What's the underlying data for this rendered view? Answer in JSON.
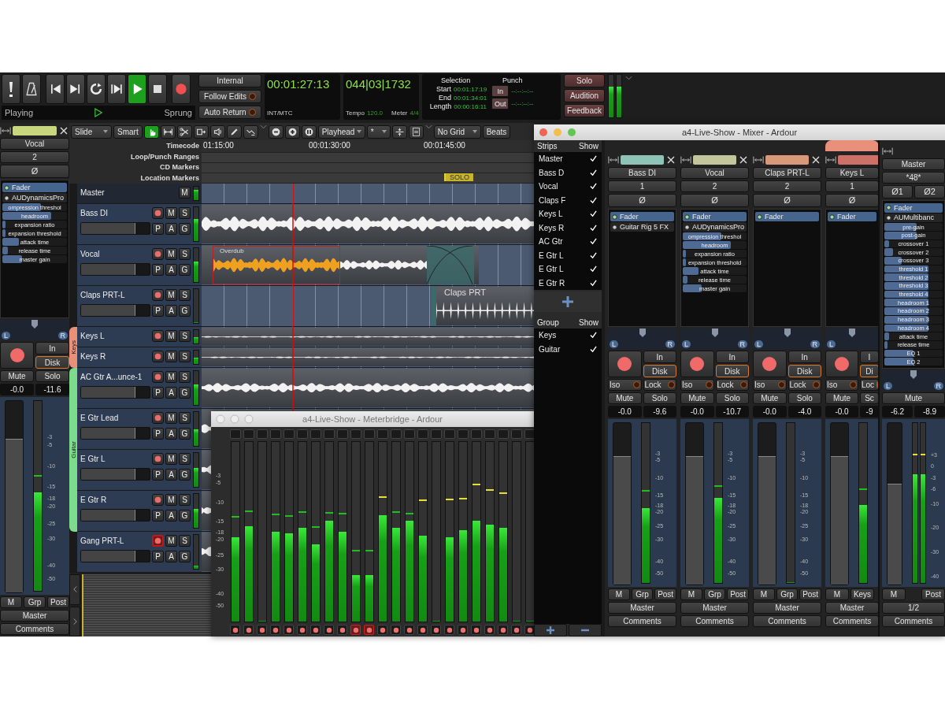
{
  "transport": {
    "buttons": [
      {
        "on": false
      },
      {
        "on": false
      },
      {
        "on": false
      },
      {
        "on": false
      },
      {
        "on": false
      },
      {
        "on": false
      },
      {
        "on": true
      },
      {
        "on": false
      },
      {
        "on": false
      }
    ],
    "status": "Playing",
    "status_right": "Sprung",
    "sync": [
      {
        "label": "Internal",
        "kind": "plain"
      },
      {
        "label": "Follow Edits",
        "kind": "led",
        "on": false
      },
      {
        "label": "Auto Return",
        "kind": "led",
        "on": false
      }
    ],
    "clocks": [
      {
        "time": "00:01:27:13",
        "footer": [
          {
            "label": "INT/MTC"
          }
        ]
      },
      {
        "time": "044|03|1732",
        "footer": [
          {
            "label": "Tempo",
            "value": "120.0"
          },
          {
            "label": "Meter",
            "value": "4/4"
          }
        ]
      }
    ],
    "selection": {
      "title": "Selection",
      "rows": [
        {
          "label": "Start",
          "value": "00:01:17:19"
        },
        {
          "label": "End",
          "value": "00:01:34:01"
        },
        {
          "label": "Length",
          "value": "00:00:16:11"
        }
      ]
    },
    "punch": {
      "title": "Punch",
      "rows": [
        {
          "button": "In",
          "value": "--:--:--:--"
        },
        {
          "button": "Out",
          "value": "--:--:--:--"
        }
      ]
    },
    "monitor_buttons": [
      "Solo",
      "Audition",
      "Feedback"
    ],
    "meters": [
      {
        "level": 0.72
      },
      {
        "level": 0.72
      }
    ]
  },
  "editor_toolbar": {
    "edit_mode": "Slide",
    "mode_button": "Smart",
    "tools": [
      {
        "selected": true
      },
      {
        "selected": false
      },
      {
        "selected": false
      },
      {
        "selected": false
      },
      {
        "selected": false
      },
      {
        "selected": false
      },
      {
        "selected": false
      }
    ],
    "zoom_focus": "Playhead",
    "snap": "*",
    "grid": "No Grid",
    "grid_unit": "Beats"
  },
  "rulers": [
    {
      "label": "Timecode"
    },
    {
      "label": "Loop/Punch Ranges"
    },
    {
      "label": "CD Markers"
    },
    {
      "label": "Location Markers"
    }
  ],
  "timecode_ticks": [
    "01:15:00",
    "00:01:30:00",
    "00:01:45:00"
  ],
  "markers": [
    {
      "label": "SOLO"
    }
  ],
  "master_track": {
    "name": "Master",
    "buttons": [
      "M"
    ],
    "meter": {
      "level": 0.75
    }
  },
  "track_list": [
    {
      "name": "Bass DI",
      "kind": "full",
      "expanded": true,
      "rec_armed": false,
      "buttons": [
        "M",
        "S"
      ],
      "extra_buttons": [
        "P",
        "A",
        "G"
      ],
      "fader": {
        "level": 0.78
      },
      "meter": {
        "level": 0.65
      }
    },
    {
      "name": "Vocal",
      "kind": "overdub",
      "expanded": true,
      "rec_armed": false,
      "buttons": [
        "M",
        "S"
      ],
      "extra_buttons": [
        "P",
        "A",
        "G"
      ],
      "fader": {
        "level": 0.78
      },
      "meter": {
        "level": 0.6
      },
      "region_label": "Overdub"
    },
    {
      "name": "Claps PRT-L",
      "kind": "claps",
      "expanded": true,
      "rec_armed": false,
      "buttons": [
        "M",
        "S"
      ],
      "extra_buttons": [
        "P",
        "A",
        "G"
      ],
      "fader": {
        "level": 0.78
      },
      "meter": {
        "level": 0
      },
      "region_label": "Claps PRT"
    },
    {
      "group": "Keys",
      "color": "#e8907a",
      "tracks": [
        {
          "name": "Keys L",
          "kind": "thin",
          "expanded": false,
          "rec_armed": false,
          "buttons": [
            "M",
            "S"
          ],
          "meter": {
            "level": 0.5
          }
        },
        {
          "name": "Keys R",
          "kind": "thin",
          "expanded": false,
          "rec_armed": false,
          "buttons": [
            "M",
            "S"
          ],
          "meter": {
            "level": 0.5
          }
        }
      ]
    },
    {
      "group": "Guitar",
      "color": "#7ddc8c",
      "tracks": [
        {
          "name": "AC Gtr A...unce-1",
          "kind": "dense",
          "expanded": true,
          "rec_armed": false,
          "buttons": [
            "M",
            "S"
          ],
          "extra_buttons": [
            "P",
            "A",
            "G"
          ],
          "fader": {
            "level": 0.78
          },
          "meter": {
            "level": 0.6
          }
        },
        {
          "name": "E Gtr Lead",
          "kind": "dense",
          "expanded": true,
          "rec_armed": false,
          "buttons": [
            "M",
            "S"
          ],
          "extra_buttons": [
            "P",
            "A",
            "G"
          ],
          "fader": {
            "level": 0.78
          },
          "meter": {
            "level": 0.5
          }
        },
        {
          "name": "E Gtr L",
          "kind": "dense",
          "expanded": true,
          "rec_armed": false,
          "buttons": [
            "M",
            "S"
          ],
          "extra_buttons": [
            "P",
            "A",
            "G"
          ],
          "fader": {
            "level": 0.78
          },
          "meter": {
            "level": 0.55
          }
        },
        {
          "name": "E Gtr R",
          "kind": "dense",
          "expanded": true,
          "rec_armed": false,
          "buttons": [
            "M",
            "S"
          ],
          "extra_buttons": [
            "P",
            "A",
            "G"
          ],
          "fader": {
            "level": 0.78
          },
          "meter": {
            "level": 0.55
          }
        }
      ]
    },
    {
      "name": "Gang PRT-L",
      "kind": "dense",
      "expanded": true,
      "rec_armed": true,
      "buttons": [
        "M",
        "S"
      ],
      "extra_buttons": [
        "P",
        "A",
        "G"
      ],
      "fader": {
        "level": 0.78
      },
      "meter": {
        "level": 0.1
      }
    }
  ],
  "editor_strip": {
    "color": "#c8d67e",
    "name": "Vocal",
    "input": "2",
    "phase": [
      "Ø"
    ],
    "plugins": [
      {
        "name": "Fader",
        "active": true
      },
      {
        "name": "AUDynamicsPro",
        "active": false,
        "params": [
          {
            "name": "ompression threshol",
            "level": 0.6
          },
          {
            "name": "headroom",
            "level": 0.75
          },
          {
            "name": "expansion ratio",
            "level": 0.05
          },
          {
            "name": "expansion threshold",
            "level": 0.05
          },
          {
            "name": "attack time",
            "level": 0.25
          },
          {
            "name": "release time",
            "level": 0.08
          },
          {
            "name": "master gain",
            "level": 0.3
          }
        ]
      }
    ],
    "panner": {
      "left": "L",
      "right": "R"
    },
    "rec_armed": false,
    "monitor": [
      {
        "label": "In",
        "selected": false
      },
      {
        "label": "Disk",
        "selected": true
      }
    ],
    "mute": "Mute",
    "solo": "Solo",
    "gain": "-0.0",
    "peak": "-11.6",
    "fader": {
      "level": 0.8
    },
    "meter": {
      "level": 0.52,
      "peak": {
        "level": 0.6
      }
    },
    "scale": [
      "-3",
      "-5",
      "-10",
      "-15",
      "-18",
      "-20",
      "-25",
      "-30",
      "-40",
      "-50"
    ],
    "bottom": [
      "M",
      "Grp",
      "Post"
    ],
    "output": "Master",
    "comments": "Comments"
  },
  "mixer": {
    "title": "a4-Live-Show - Mixer - Ardour",
    "strips_header": {
      "title": "Strips",
      "show": "Show"
    },
    "strip_list": [
      {
        "name": "Master",
        "checked": true
      },
      {
        "name": "Bass D",
        "checked": true
      },
      {
        "name": "Vocal",
        "checked": true
      },
      {
        "name": "Claps F",
        "checked": true
      },
      {
        "name": "Keys L",
        "checked": true
      },
      {
        "name": "Keys R",
        "checked": true
      },
      {
        "name": "AC Gtr",
        "checked": true
      },
      {
        "name": "E Gtr L",
        "checked": true
      },
      {
        "name": "E Gtr L",
        "checked": true
      },
      {
        "name": "E Gtr R",
        "checked": true
      }
    ],
    "groups_header": {
      "title": "Group",
      "show": "Show"
    },
    "group_list": [
      {
        "name": "Keys",
        "checked": true
      },
      {
        "name": "Guitar",
        "checked": true
      }
    ],
    "strips": [
      {
        "kind": "full",
        "color": "#8fc3b5",
        "name": "Bass DI",
        "input": "1",
        "phase": "Ø",
        "plugins": [
          {
            "name": "Fader",
            "active": true
          },
          {
            "name": "Guitar Rig 5 FX",
            "active": false
          }
        ],
        "panner": {
          "left": "L",
          "right": "R"
        },
        "rec_armed": false,
        "monitor": [
          {
            "label": "In",
            "selected": false
          },
          {
            "label": "Disk",
            "selected": true
          }
        ],
        "iso": {
          "label": "Iso",
          "on": false
        },
        "lock": {
          "label": "Lock",
          "on": false
        },
        "mute": "Mute",
        "solo": "Solo",
        "gain": "-0.0",
        "peak": "-9.6",
        "fader": {
          "level": 0.79
        },
        "meter": {
          "level": 0.47,
          "peak": {
            "level": 0.57
          }
        },
        "scale": [
          "-3",
          "-5",
          "-10",
          "-15",
          "-18",
          "-20",
          "-25",
          "-30",
          "-40",
          "-50"
        ],
        "bottom": [
          "M",
          "Grp",
          "Post"
        ],
        "output": "Master",
        "comments": "Comments"
      },
      {
        "kind": "full",
        "color": "#c3c69c",
        "name": "Vocal",
        "input": "2",
        "phase": "Ø",
        "plugins": [
          {
            "name": "Fader",
            "active": true
          },
          {
            "name": "AUDynamicsPro",
            "active": false,
            "params": [
              {
                "name": "ompression threshol",
                "level": 0.6
              },
              {
                "name": "headroom",
                "level": 0.75
              },
              {
                "name": "expansion ratio",
                "level": 0.05
              },
              {
                "name": "expansion threshold",
                "level": 0.05
              },
              {
                "name": "attack time",
                "level": 0.25
              },
              {
                "name": "release time",
                "level": 0.08
              },
              {
                "name": "master gain",
                "level": 0.3
              }
            ]
          }
        ],
        "panner": {
          "left": "L",
          "right": "R"
        },
        "rec_armed": false,
        "monitor": [
          {
            "label": "In",
            "selected": false
          },
          {
            "label": "Disk",
            "selected": true
          }
        ],
        "iso": {
          "label": "Iso",
          "on": false
        },
        "lock": {
          "label": "Lock",
          "on": false
        },
        "mute": "Mute",
        "solo": "Solo",
        "gain": "-0.0",
        "peak": "-10.7",
        "fader": {
          "level": 0.79
        },
        "meter": {
          "level": 0.53,
          "peak": {
            "level": 0.6
          }
        },
        "scale": [
          "-3",
          "-5",
          "-10",
          "-15",
          "-18",
          "-20",
          "-25",
          "-30",
          "-40",
          "-50"
        ],
        "bottom": [
          "M",
          "Grp",
          "Post"
        ],
        "output": "Master",
        "comments": "Comments"
      },
      {
        "kind": "full",
        "color": "#d9987a",
        "name": "Claps PRT-L",
        "input": "2",
        "phase": "Ø",
        "plugins": [
          {
            "name": "Fader",
            "active": true
          }
        ],
        "panner": {
          "left": "L",
          "right": "R"
        },
        "rec_armed": false,
        "monitor": [
          {
            "label": "In",
            "selected": false
          },
          {
            "label": "Disk",
            "selected": true
          }
        ],
        "iso": {
          "label": "Iso",
          "on": false
        },
        "lock": {
          "label": "Lock",
          "on": false
        },
        "mute": "Mute",
        "solo": "Solo",
        "gain": "-0.0",
        "peak": "-4.0",
        "fader": {
          "level": 0.79
        },
        "meter": {
          "level": 0
        },
        "scale": [
          "-3",
          "-5",
          "-10",
          "-15",
          "-18",
          "-20",
          "-25",
          "-30",
          "-40",
          "-50"
        ],
        "bottom": [
          "M",
          "Grp",
          "Post"
        ],
        "output": "Master",
        "comments": "Comments"
      },
      {
        "kind": "partial",
        "color": "#cc7068",
        "group": {
          "color": "#e8907a"
        },
        "name": "Keys L",
        "input": "1",
        "phase": "Ø",
        "plugins": [
          {
            "name": "Fader",
            "active": true
          }
        ],
        "panner": {
          "left": "L"
        },
        "rec_armed": false,
        "monitor": [
          {
            "label": "I",
            "selected": false
          },
          {
            "label": "Di",
            "selected": true
          }
        ],
        "iso": {
          "label": "Iso",
          "on": false
        },
        "lock": {
          "label": "Loc",
          "on": false
        },
        "mute": "Mute",
        "solo": "Sc",
        "gain": "-0.0",
        "peak": "-9",
        "fader": {
          "level": 0.79
        },
        "meter": {
          "level": 0.49,
          "peak": {
            "level": 0.58
          }
        },
        "bottom": [
          "M",
          "Keys"
        ],
        "output": "Master",
        "comments": "Comments"
      }
    ],
    "master": {
      "name": "Master",
      "input": "*48*",
      "phase": [
        "Ø1",
        "Ø2"
      ],
      "plugins": [
        {
          "name": "Fader",
          "active": true
        },
        {
          "name": "AUMultibanc",
          "active": false,
          "params": [
            {
              "name": "pre-gain",
              "level": 0.55
            },
            {
              "name": "post-gain",
              "level": 0.55
            },
            {
              "name": "crossover 1",
              "level": 0.08
            },
            {
              "name": "crossover 2",
              "level": 0.15
            },
            {
              "name": "crossover 3",
              "level": 0.3
            },
            {
              "name": "threshold 1",
              "level": 0.75
            },
            {
              "name": "threshold 2",
              "level": 0.75
            },
            {
              "name": "threshold 3",
              "level": 0.75
            },
            {
              "name": "threshold 4",
              "level": 0.75
            },
            {
              "name": "headroom 1",
              "level": 0.75
            },
            {
              "name": "headroom 2",
              "level": 0.75
            },
            {
              "name": "headroom 3",
              "level": 0.75
            },
            {
              "name": "headroom 4",
              "level": 0.75
            },
            {
              "name": "attack time",
              "level": 0.08
            },
            {
              "name": "release time",
              "level": 0.05
            },
            {
              "name": "EQ 1",
              "level": 0.5
            },
            {
              "name": "EQ 2",
              "level": 0.5
            }
          ]
        }
      ],
      "panner": {
        "left": "L",
        "right": "R"
      },
      "mute": "Mute",
      "gain": "-6.2",
      "peak": "-8.9",
      "fader": {
        "level": 0.62
      },
      "meters": [
        {
          "level": 0.68,
          "peak": {
            "level": 0.8
          }
        },
        {
          "level": 0.68,
          "peak": {
            "level": 0.8
          }
        }
      ],
      "scale": [
        "+3",
        "0",
        "-3",
        "-6",
        "-10",
        "-20",
        "-30",
        "-40"
      ],
      "bottom": [
        "M",
        "Post"
      ],
      "output": "1/2",
      "comments": "Comments"
    }
  },
  "meterbridge": {
    "title": "a4-Live-Show - Meterbridge - Ardour",
    "scale": [
      "-3",
      "-5",
      "-10",
      "-15",
      "-18",
      "-20",
      "-25",
      "-30",
      "-40",
      "-50"
    ],
    "meters": [
      {
        "level": 0.47,
        "peak": {
          "level": 0.58
        },
        "rec_armed": false
      },
      {
        "level": 0.53,
        "peak": {
          "level": 0.61
        },
        "rec_armed": false
      },
      {
        "level": 0,
        "rec_armed": false
      },
      {
        "level": 0.5,
        "peak": {
          "level": 0.59
        },
        "rec_armed": false
      },
      {
        "level": 0.49,
        "peak": {
          "level": 0.585
        },
        "rec_armed": false
      },
      {
        "level": 0.52,
        "peak": {
          "level": 0.605
        },
        "rec_armed": false
      },
      {
        "level": 0.43,
        "peak": {
          "level": 0.52
        },
        "rec_armed": false
      },
      {
        "level": 0.56,
        "peak": {
          "level": 0.6
        },
        "rec_armed": false
      },
      {
        "level": 0.5,
        "peak": {
          "level": 0.595
        },
        "rec_armed": false
      },
      {
        "level": 0.26,
        "peak": {
          "level": 0.39
        },
        "rec_armed": true
      },
      {
        "level": 0.26,
        "peak": {
          "level": 0.39
        },
        "rec_armed": true
      },
      {
        "level": 0.59,
        "peak": {
          "level": 0.69
        },
        "rec_armed": false
      },
      {
        "level": 0.52,
        "peak": {
          "level": 0.605
        },
        "rec_armed": false
      },
      {
        "level": 0.56,
        "peak": {
          "level": 0.595
        },
        "rec_armed": false
      },
      {
        "level": 0.48,
        "peak": {
          "level": 0.67
        },
        "rec_armed": false
      },
      {
        "level": 0,
        "rec_armed": false
      },
      {
        "level": 0.47,
        "peak": {
          "level": 0.675
        },
        "rec_armed": false
      },
      {
        "level": 0.51,
        "peak": {
          "level": 0.68
        },
        "rec_armed": false
      },
      {
        "level": 0.56,
        "peak": {
          "level": 0.76
        },
        "rec_armed": false
      },
      {
        "level": 0.54,
        "peak": {
          "level": 0.73
        },
        "rec_armed": false
      },
      {
        "level": 0.52,
        "peak": {
          "level": 0.71
        },
        "rec_armed": false
      },
      {
        "level": 0,
        "rec_armed": false
      },
      {
        "level": 0,
        "rec_armed": false
      }
    ]
  }
}
